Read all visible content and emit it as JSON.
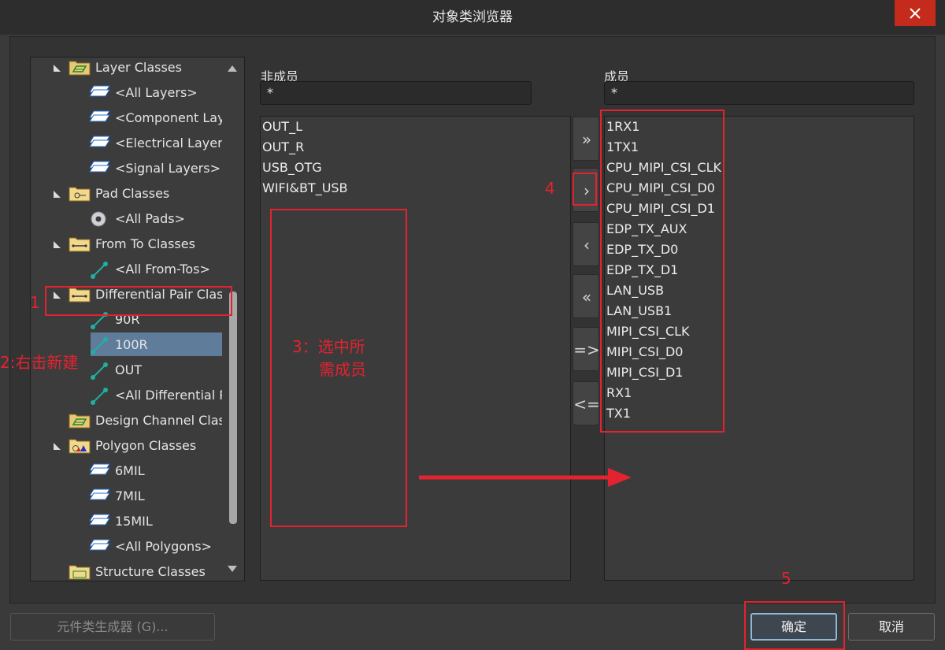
{
  "window": {
    "title": "对象类浏览器",
    "close_icon": "close-icon"
  },
  "tree": {
    "items": [
      {
        "label": "Layer Classes",
        "kind": "folder-green",
        "level": 0,
        "expanded": true
      },
      {
        "label": "<All Layers>",
        "kind": "layer",
        "level": 1
      },
      {
        "label": "<Component Laye",
        "kind": "layer",
        "level": 1
      },
      {
        "label": "<Electrical Layers>",
        "kind": "layer",
        "level": 1
      },
      {
        "label": "<Signal Layers>",
        "kind": "layer",
        "level": 1
      },
      {
        "label": "Pad Classes",
        "kind": "folder-pad",
        "level": 0,
        "expanded": true
      },
      {
        "label": "<All Pads>",
        "kind": "pad",
        "level": 1
      },
      {
        "label": "From To Classes",
        "kind": "folder-fromto",
        "level": 0,
        "expanded": true
      },
      {
        "label": "<All From-Tos>",
        "kind": "net",
        "level": 1
      },
      {
        "label": "Differential Pair Class",
        "kind": "folder-fromto",
        "level": 0,
        "expanded": true
      },
      {
        "label": "90R",
        "kind": "net",
        "level": 1
      },
      {
        "label": "100R",
        "kind": "net",
        "level": 1,
        "selected": true
      },
      {
        "label": "OUT",
        "kind": "net",
        "level": 1
      },
      {
        "label": "<All Differential Pa",
        "kind": "net",
        "level": 1
      },
      {
        "label": "Design Channel Class",
        "kind": "folder-green",
        "level": 0,
        "expanded": false
      },
      {
        "label": "Polygon Classes",
        "kind": "folder-poly",
        "level": 0,
        "expanded": true
      },
      {
        "label": "6MIL",
        "kind": "layer",
        "level": 1
      },
      {
        "label": "7MIL",
        "kind": "layer",
        "level": 1
      },
      {
        "label": "15MIL",
        "kind": "layer",
        "level": 1
      },
      {
        "label": "<All Polygons>",
        "kind": "layer",
        "level": 1
      },
      {
        "label": "Structure Classes",
        "kind": "folder-struct",
        "level": 0,
        "expanded": false
      }
    ]
  },
  "non_members": {
    "header": "非成员",
    "filter_value": "*",
    "items": [
      "OUT_L",
      "OUT_R",
      "USB_OTG",
      "WIFI&BT_USB"
    ]
  },
  "members": {
    "header": "成员",
    "filter_value": "*",
    "items": [
      "1RX1",
      "1TX1",
      "CPU_MIPI_CSI_CLK",
      "CPU_MIPI_CSI_D0",
      "CPU_MIPI_CSI_D1",
      "EDP_TX_AUX",
      "EDP_TX_D0",
      "EDP_TX_D1",
      "LAN_USB",
      "LAN_USB1",
      "MIPI_CSI_CLK",
      "MIPI_CSI_D0",
      "MIPI_CSI_D1",
      "RX1",
      "TX1"
    ]
  },
  "transfer_buttons": [
    {
      "name": "add-all-button",
      "glyph": "»"
    },
    {
      "name": "add-selected-button",
      "glyph": "›"
    },
    {
      "name": "remove-selected-button",
      "glyph": "‹"
    },
    {
      "name": "remove-all-button",
      "glyph": "«"
    },
    {
      "name": "add-filtered-button",
      "glyph": "=>"
    },
    {
      "name": "remove-filtered-button",
      "glyph": "<="
    }
  ],
  "footer": {
    "generator_label": "元件类生成器 (G)...",
    "ok_label": "确定",
    "cancel_label": "取消"
  },
  "annotations": {
    "step1": "1",
    "step2": "2:右击新建",
    "step3_line1": "3：选中所",
    "step3_line2": "需成员",
    "step4": "4",
    "step5": "5"
  },
  "colors": {
    "annotation_red": "#e3232f",
    "selection": "#5f7d9b",
    "close_red": "#c42b1c"
  }
}
